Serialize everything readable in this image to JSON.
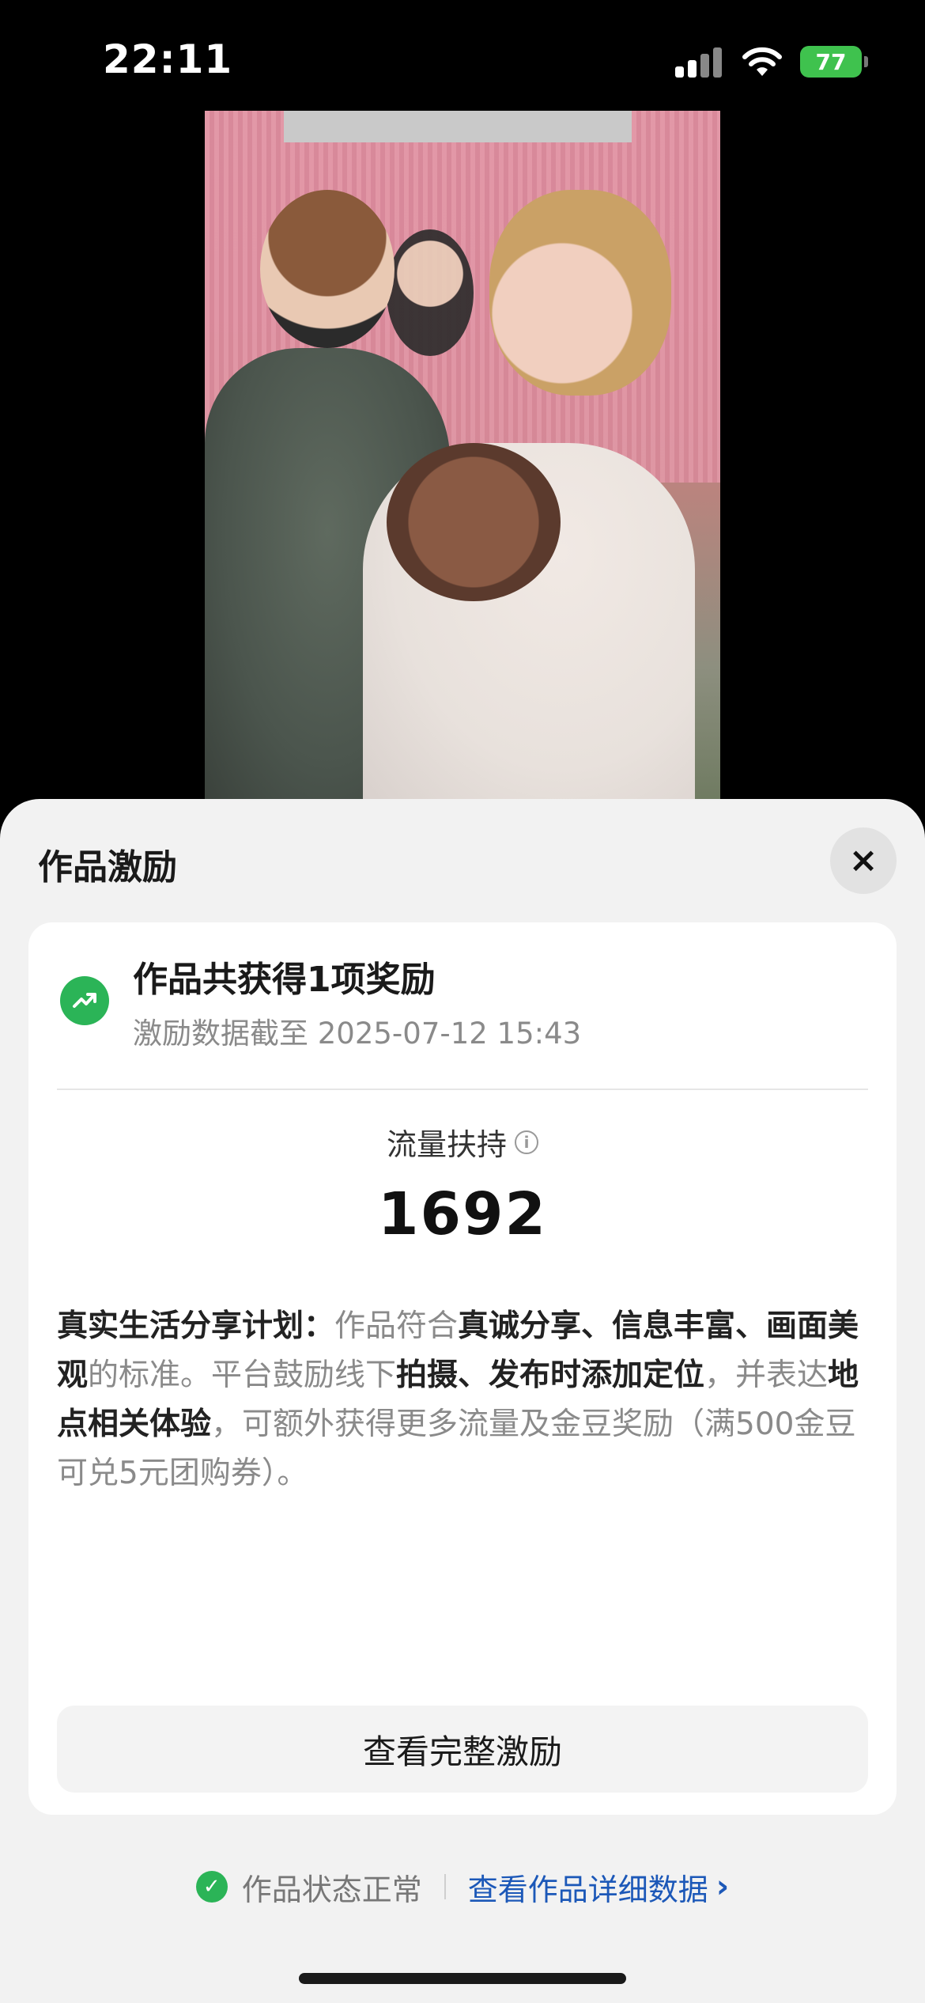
{
  "status_bar": {
    "time": "22:11",
    "battery": "77"
  },
  "sheet": {
    "title": "作品激励",
    "close_icon": "×"
  },
  "reward_card": {
    "title": "作品共获得1项奖励",
    "date": "激励数据截至 2025-07-12 15:43",
    "metric_label": "流量扶持",
    "metric_value": "1692",
    "description": {
      "plan_name": "真实生活分享计划：",
      "seg1": "作品符合",
      "bold1": "真诚分享、信息丰富、画面美观",
      "seg2": "的标准。平台鼓励线下",
      "bold2": "拍摄、发布时添加定位",
      "seg3": "，并表达",
      "bold3": "地点相关体验",
      "seg4": "，可额外获得更多流量及金豆奖励（满500金豆可兑5元团购券）。"
    },
    "button_label": "查看完整激励"
  },
  "footer": {
    "status_text": "作品状态正常",
    "detail_link": "查看作品详细数据"
  },
  "colors": {
    "accent_green": "#2bb457",
    "link_blue": "#1c58b8",
    "battery_green": "#3fc24e"
  },
  "icons": [
    "signal-icon",
    "wifi-icon",
    "battery-icon",
    "close-icon",
    "trend-up-icon",
    "info-icon",
    "check-icon",
    "chevron-right-icon"
  ]
}
